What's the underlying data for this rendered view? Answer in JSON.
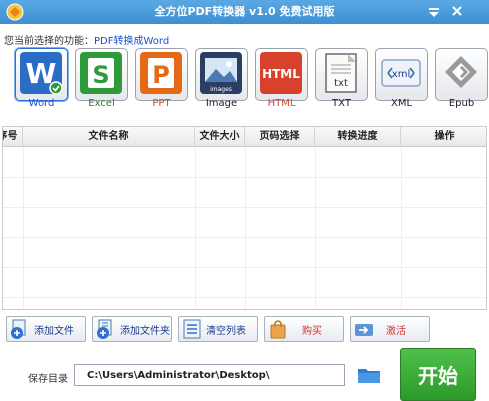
{
  "window": {
    "title": "全方位PDF转换器 v1.0 免费试用版"
  },
  "function_bar": {
    "label": "您当前选择的功能：",
    "selected": "PDF转换成Word"
  },
  "formats": [
    {
      "label": "Word",
      "glyph": "W",
      "color": "#2b6cc4"
    },
    {
      "label": "Excel",
      "glyph": "S",
      "color": "#2e9a3a"
    },
    {
      "label": "PPT",
      "glyph": "P",
      "color": "#e56a18"
    },
    {
      "label": "Image",
      "glyph": "images",
      "color": "#2a3f63"
    },
    {
      "label": "HTML",
      "glyph": "HTML",
      "color": "#d8422c"
    },
    {
      "label": "TXT",
      "glyph": "txt",
      "color": "#6b6b6b"
    },
    {
      "label": "XML",
      "glyph": "xml",
      "color": "#3a6fb0"
    },
    {
      "label": "Epub",
      "glyph": "",
      "color": "#8a8a8a"
    }
  ],
  "table": {
    "columns": [
      "序号",
      "文件名称",
      "文件大小",
      "页码选择",
      "转换进度",
      "操作"
    ],
    "rows": []
  },
  "actions": {
    "add_file": "添加文件",
    "add_folder": "添加文件夹",
    "clear_list": "清空列表",
    "buy": "购买",
    "activate": "激活"
  },
  "save": {
    "label": "保存目录",
    "path": "C:\\Users\\Administrator\\Desktop\\"
  },
  "start": {
    "label": "开始"
  },
  "colors": {
    "titlebar": "#4a9cdc",
    "start": "#34a832",
    "link": "#1a4fd0"
  }
}
